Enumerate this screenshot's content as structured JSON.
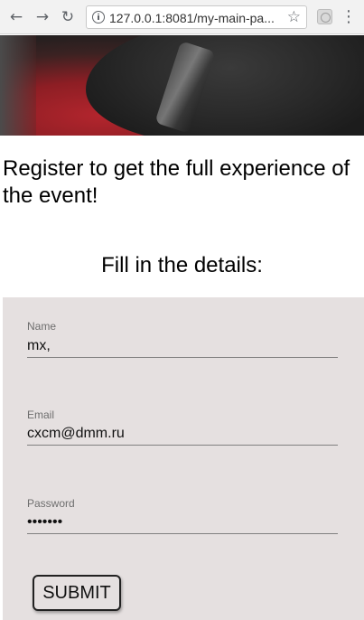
{
  "browser": {
    "url": "127.0.0.1:8081/my-main-pa...",
    "icons": {
      "back": "arrow-left-icon",
      "forward": "arrow-right-icon",
      "reload": "reload-icon",
      "info": "info-icon",
      "bookmark": "star-icon",
      "extension": "extension-icon",
      "menu": "kebab-menu-icon"
    }
  },
  "page": {
    "intro_text": "Register to get the full experience of the event!",
    "subtitle": "Fill in the details:"
  },
  "form": {
    "name": {
      "label": "Name",
      "value": "mx,"
    },
    "email": {
      "label": "Email",
      "value": "cxcm@dmm.ru"
    },
    "password": {
      "label": "Password",
      "value": "1234567"
    },
    "submit_label": "SUBMIT"
  },
  "colors": {
    "form_background": "#e5e0e0",
    "hero_accent": "#b3252d"
  }
}
